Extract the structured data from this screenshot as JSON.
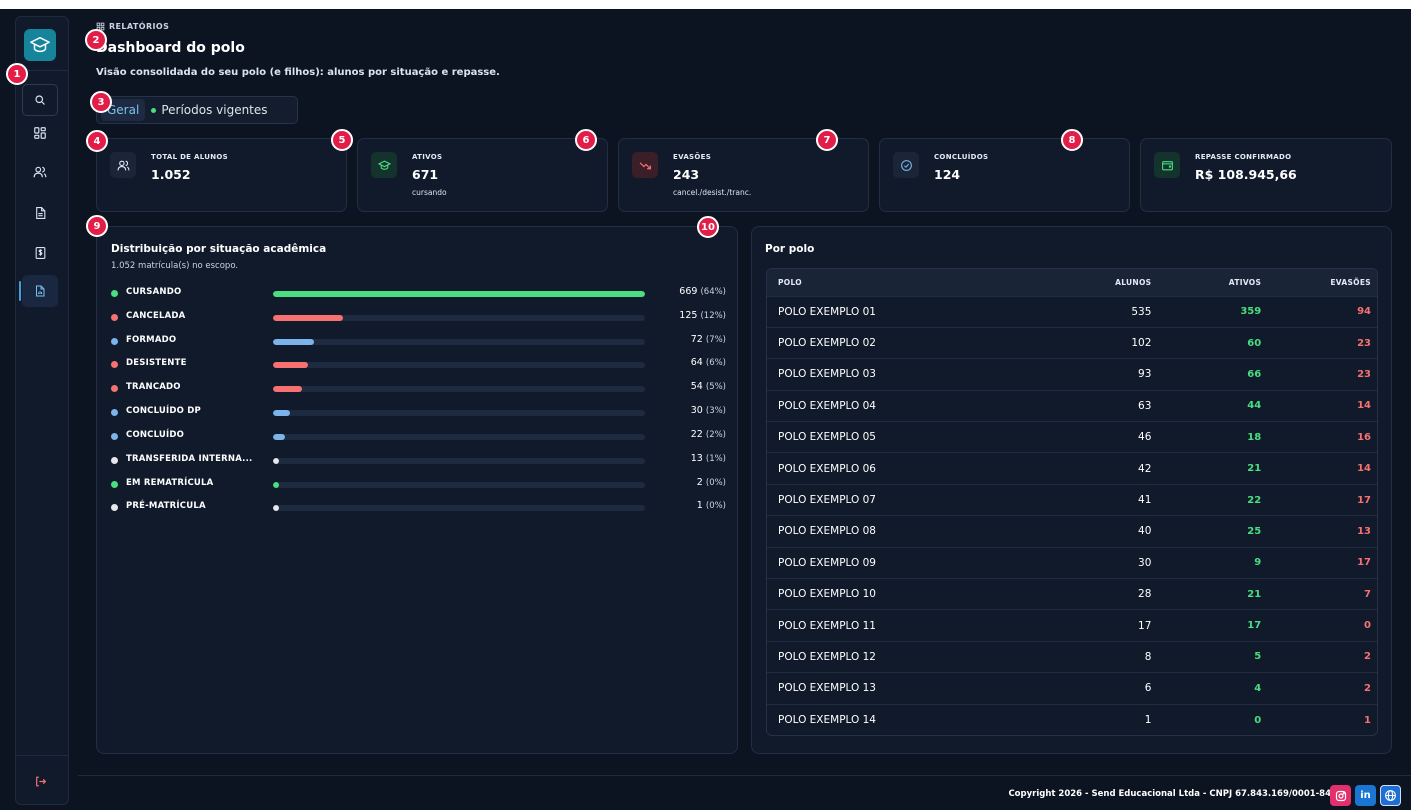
{
  "sidebar": {
    "items": [
      {
        "name": "search",
        "icon": "search-icon"
      },
      {
        "name": "dashboard",
        "icon": "grid-icon"
      },
      {
        "name": "users",
        "icon": "users-icon"
      },
      {
        "name": "documents",
        "icon": "document-icon"
      },
      {
        "name": "finance",
        "icon": "dollar-document-icon"
      },
      {
        "name": "reports",
        "icon": "report-icon",
        "active": true
      }
    ],
    "logout_icon": "logout-icon"
  },
  "badges": [
    "1",
    "2",
    "3",
    "4",
    "5",
    "6",
    "7",
    "8",
    "9",
    "10"
  ],
  "header": {
    "breadcrumb": "RELATÓRIOS",
    "title": "Dashboard do polo",
    "subtitle": "Visão consolidada do seu polo (e filhos): alunos por situação e repasse."
  },
  "tabs": [
    {
      "label": "Geral",
      "active": true
    },
    {
      "label": "Períodos vigentes",
      "active": false
    }
  ],
  "kpis": [
    {
      "label": "TOTAL DE ALUNOS",
      "value": "1.052",
      "sub": "",
      "icon": "users-icon"
    },
    {
      "label": "ATIVOS",
      "value": "671",
      "sub": "cursando",
      "icon": "graduation-cap-icon"
    },
    {
      "label": "EVASÕES",
      "value": "243",
      "sub": "cancel./desist./tranc.",
      "icon": "trending-down-icon"
    },
    {
      "label": "CONCLUÍDOS",
      "value": "124",
      "sub": "",
      "icon": "check-circle-icon"
    },
    {
      "label": "REPASSE CONFIRMADO",
      "value": "R$ 108.945,66",
      "sub": "",
      "icon": "wallet-icon"
    }
  ],
  "distribution": {
    "title": "Distribuição por situação acadêmica",
    "subtitle": "1.052 matrícula(s) no escopo.",
    "rows": [
      {
        "name": "CURSANDO",
        "count": "669",
        "pct": "(64%)",
        "fraction": 0.64,
        "color": "#4ade80"
      },
      {
        "name": "CANCELADA",
        "count": "125",
        "pct": "(12%)",
        "fraction": 0.12,
        "color": "#f87171"
      },
      {
        "name": "FORMADO",
        "count": "72",
        "pct": "(7%)",
        "fraction": 0.07,
        "color": "#7ab4ea"
      },
      {
        "name": "DESISTENTE",
        "count": "64",
        "pct": "(6%)",
        "fraction": 0.06,
        "color": "#f87171"
      },
      {
        "name": "TRANCADO",
        "count": "54",
        "pct": "(5%)",
        "fraction": 0.05,
        "color": "#f87171"
      },
      {
        "name": "CONCLUÍDO DP",
        "count": "30",
        "pct": "(3%)",
        "fraction": 0.03,
        "color": "#7ab4ea"
      },
      {
        "name": "CONCLUÍDO",
        "count": "22",
        "pct": "(2%)",
        "fraction": 0.02,
        "color": "#7ab4ea"
      },
      {
        "name": "TRANSFERIDA INTERNA...",
        "count": "13",
        "pct": "(1%)",
        "fraction": 0.01,
        "color": "#e5e7eb"
      },
      {
        "name": "EM REMATRÍCULA",
        "count": "2",
        "pct": "(0%)",
        "fraction": 0.0,
        "color": "#4ade80"
      },
      {
        "name": "PRÉ-MATRÍCULA",
        "count": "1",
        "pct": "(0%)",
        "fraction": 0.0,
        "color": "#e5e7eb"
      }
    ]
  },
  "by_polo": {
    "title": "Por polo",
    "columns": [
      "POLO",
      "ALUNOS",
      "ATIVOS",
      "EVASÕES"
    ],
    "rows": [
      [
        "POLO EXEMPLO 01",
        "535",
        "359",
        "94"
      ],
      [
        "POLO EXEMPLO 02",
        "102",
        "60",
        "23"
      ],
      [
        "POLO EXEMPLO 03",
        "93",
        "66",
        "23"
      ],
      [
        "POLO EXEMPLO 04",
        "63",
        "44",
        "14"
      ],
      [
        "POLO EXEMPLO 05",
        "46",
        "18",
        "16"
      ],
      [
        "POLO EXEMPLO 06",
        "42",
        "21",
        "14"
      ],
      [
        "POLO EXEMPLO 07",
        "41",
        "22",
        "17"
      ],
      [
        "POLO EXEMPLO 08",
        "40",
        "25",
        "13"
      ],
      [
        "POLO EXEMPLO 09",
        "30",
        "9",
        "17"
      ],
      [
        "POLO EXEMPLO 10",
        "28",
        "21",
        "7"
      ],
      [
        "POLO EXEMPLO 11",
        "17",
        "17",
        "0"
      ],
      [
        "POLO EXEMPLO 12",
        "8",
        "5",
        "2"
      ],
      [
        "POLO EXEMPLO 13",
        "6",
        "4",
        "2"
      ],
      [
        "POLO EXEMPLO 14",
        "1",
        "0",
        "1"
      ]
    ]
  },
  "footer": {
    "copyright": "Copyright 2026 - Send Educacional Ltda - CNPJ 67.843.169/0001-84",
    "social": [
      {
        "icon": "instagram-icon",
        "color": "#e1306c"
      },
      {
        "icon": "linkedin-icon",
        "color": "#1976d2",
        "label": "in"
      },
      {
        "icon": "globe-icon",
        "color": "#1d6fd6"
      }
    ]
  },
  "colors": {
    "background": "#0c1321",
    "panel": "#111a2b",
    "accent": "#16849b",
    "success": "#4ade80",
    "danger": "#f87171",
    "info": "#7ab4ea",
    "badge": "#e11d48"
  }
}
